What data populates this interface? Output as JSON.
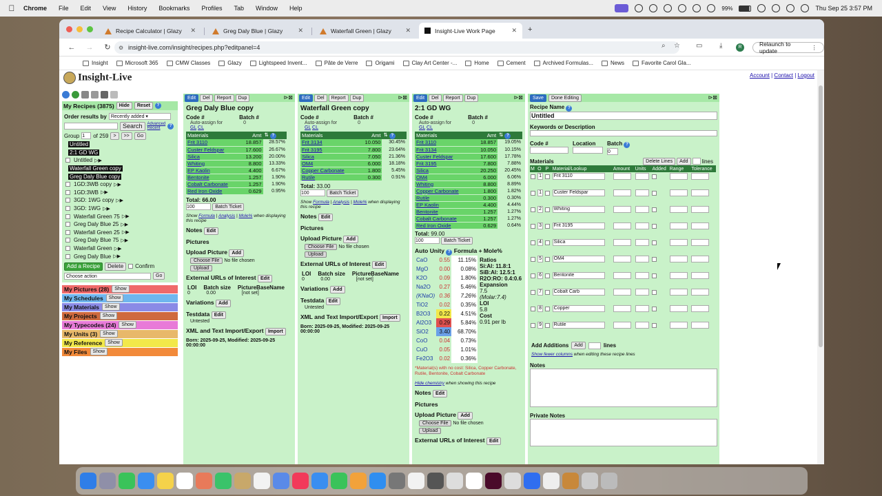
{
  "menubar": {
    "app": "Chrome",
    "items": [
      "File",
      "Edit",
      "View",
      "History",
      "Bookmarks",
      "Profiles",
      "Tab",
      "Window",
      "Help"
    ],
    "battery": "99%",
    "clock": "Thu Sep 25  3:57 PM"
  },
  "tabs": [
    {
      "title": "Recipe Calculator | Glazy"
    },
    {
      "title": "Greg Daly Blue | Glazy"
    },
    {
      "title": "Waterfall Green | Glazy"
    },
    {
      "title": "Insight-Live Work Page"
    }
  ],
  "address": {
    "url": "insight-live.com/insight/recipes.php?editpanel=4",
    "relaunch": "Relaunch to update"
  },
  "bookmarks": [
    "Insight",
    "Microsoft 365",
    "CMW Classes",
    "Glazy",
    "Lightspeed Invent...",
    "Pâte de Verre",
    "Origami",
    "Clay Art Center -...",
    "Home",
    "Cement",
    "Archived Formulas...",
    "News",
    "Favorite Carol Gla..."
  ],
  "header": {
    "logo": "Insight-Live",
    "links": [
      "Account",
      "Contact",
      "Logout"
    ]
  },
  "sidebar": {
    "my_recipes": "My Recipes (3875)",
    "hide": "Hide",
    "reset": "Reset",
    "order_label": "Order results by",
    "order_value": "Recently added",
    "search_btn": "Search",
    "advanced": "Advanced",
    "recent": "Recent",
    "group_label": "Group",
    "group_value": "1",
    "group_of": "of 259",
    "go": "Go",
    "recipes": [
      {
        "name": "Untitled",
        "sel": true
      },
      {
        "name": "2:1 GD WG",
        "sel": true
      },
      {
        "name": "Untitled",
        "sel": false
      },
      {
        "name": "Waterfall Green copy",
        "sel": true
      },
      {
        "name": "Greg Daly Blue copy",
        "sel": true
      },
      {
        "name": "1GD:3WB copy",
        "sel": false
      },
      {
        "name": "1GD:3WB",
        "sel": false
      },
      {
        "name": "3GD: 1WG copy",
        "sel": false
      },
      {
        "name": "3GD: 1WG",
        "sel": false
      },
      {
        "name": "Waterfall Green 75",
        "sel": false
      },
      {
        "name": "Greg Daly Blue 25",
        "sel": false
      },
      {
        "name": "Waterfall Green 25",
        "sel": false
      },
      {
        "name": "Greg Daly Blue 75",
        "sel": false
      },
      {
        "name": "Waterfall Green",
        "sel": false
      },
      {
        "name": "Greg Daly Blue",
        "sel": false
      }
    ],
    "add_recipe": "Add a Recipe",
    "delete": "Delete",
    "confirm": "Confirm",
    "choose_action": "Choose action",
    "categories": [
      {
        "label": "My Pictures (28)",
        "btn": "Show",
        "color": "#ef6a6a"
      },
      {
        "label": "My Schedules",
        "btn": "Show",
        "color": "#6fb6ee"
      },
      {
        "label": "My Materials",
        "btn": "Show",
        "color": "#8a8ae6"
      },
      {
        "label": "My Projects",
        "btn": "Show",
        "color": "#cf6a3e"
      },
      {
        "label": "My Typecodes (24)",
        "btn": "Show",
        "color": "#e87ad8"
      },
      {
        "label": "My Units (3)",
        "btn": "Show",
        "color": "#e8b86a"
      },
      {
        "label": "My Reference",
        "btn": "Show",
        "color": "#f2e84a"
      },
      {
        "label": "My Files",
        "btn": "Show",
        "color": "#f28a3a"
      }
    ]
  },
  "panel_buttons": {
    "edit": "Edit",
    "del": "Del",
    "report": "Report",
    "dup": "Dup"
  },
  "labels": {
    "code": "Code #",
    "batch": "Batch #",
    "auto_assign": "Auto-assign for",
    "gl": "GL",
    "cl": "CL",
    "materials": "Materials",
    "amt": "Amt",
    "total": "Total:",
    "batch_ticket": "Batch Ticket",
    "show": "Show",
    "formula": "Formula",
    "analysis": "Analysis",
    "mole": "Mole%",
    "when_disp": "when displaying this recipe",
    "notes": "Notes",
    "pictures": "Pictures",
    "upload_picture": "Upload Picture",
    "add": "Add",
    "choose_file": "Choose File",
    "no_file": "No file chosen",
    "upload": "Upload",
    "ext_urls": "External URLs of Interest",
    "edit": "Edit",
    "loi": "LOI",
    "batch_size": "Batch size",
    "pbn": "PictureBaseName",
    "variations": "Variations",
    "testdata": "Testdata",
    "untested": "Untested",
    "xml": "XML and Text Import/Export",
    "import": "Import"
  },
  "recipes": [
    {
      "title": "Greg Daly Blue copy",
      "batch_no": "0",
      "materials": [
        [
          "Frit 3110",
          "18.857",
          "28.57%"
        ],
        [
          "Custer Feldspar",
          "17.600",
          "26.67%"
        ],
        [
          "Silica",
          "13.200",
          "20.00%"
        ],
        [
          "Whiting",
          "8.800",
          "13.33%"
        ],
        [
          "EP Kaolin",
          "4.400",
          "6.67%"
        ],
        [
          "Bentonite",
          "1.257",
          "1.90%"
        ],
        [
          "Cobalt Carbonate",
          "1.257",
          "1.90%"
        ],
        [
          "Red Iron Oxide",
          "0.629",
          "0.95%"
        ]
      ],
      "total": "66.00",
      "batch_size": "100",
      "loi": "0",
      "bsize": "0.00",
      "pbn": "[not set]",
      "born": "Born: 2025-09-25, Modified: 2025-09-25 00:00:00"
    },
    {
      "title": "Waterfall Green copy",
      "batch_no": "0",
      "materials": [
        [
          "Frit 3134",
          "10.050",
          "30.45%"
        ],
        [
          "Frit 3195",
          "7.800",
          "23.64%"
        ],
        [
          "Silica",
          "7.050",
          "21.36%"
        ],
        [
          "OM4",
          "6.000",
          "18.18%"
        ],
        [
          "Copper Carbonate",
          "1.800",
          "5.45%"
        ],
        [
          "Rutile",
          "0.300",
          "0.91%"
        ]
      ],
      "total": "33.00",
      "batch_size": "100",
      "loi": "0",
      "bsize": "0.00",
      "pbn": "[not set]",
      "born": "Born: 2025-09-25, Modified: 2025-09-25 00:00:00"
    },
    {
      "title": "2:1 GD WG",
      "batch_no": "0",
      "materials": [
        [
          "Frit 3110",
          "18.857",
          "19.05%"
        ],
        [
          "Frit 3134",
          "10.050",
          "10.15%"
        ],
        [
          "Custer Feldspar",
          "17.600",
          "17.78%"
        ],
        [
          "Frit 3195",
          "7.800",
          "7.88%"
        ],
        [
          "Silica",
          "20.250",
          "20.45%"
        ],
        [
          "OM4",
          "6.000",
          "6.06%"
        ],
        [
          "Whiting",
          "8.800",
          "8.89%"
        ],
        [
          "Copper Carbonate",
          "1.800",
          "1.82%"
        ],
        [
          "Rutile",
          "0.300",
          "0.30%"
        ],
        [
          "EP Kaolin",
          "4.400",
          "4.44%"
        ],
        [
          "Bentonite",
          "1.257",
          "1.27%"
        ],
        [
          "Cobalt Carbonate",
          "1.257",
          "1.27%"
        ],
        [
          "Red Iron Oxide",
          "0.629",
          "0.64%"
        ]
      ],
      "total": "99.00",
      "batch_size": "100"
    }
  ],
  "chem": {
    "auto_unity": "Auto Unity",
    "mode": "Formula + Mole%",
    "rows": [
      [
        "CaO",
        "0.55",
        "11.15%"
      ],
      [
        "MgO",
        "0.00",
        "0.08%"
      ],
      [
        "K2O",
        "0.09",
        "1.80%"
      ],
      [
        "Na2O",
        "0.27",
        "5.46%"
      ],
      [
        "(KNaO)",
        "0.36",
        "7.26%"
      ],
      [
        "TiO2",
        "0.02",
        "0.35%"
      ],
      [
        "B2O3",
        "0.22",
        "4.51%"
      ],
      [
        "Al2O3",
        "0.29",
        "5.84%"
      ],
      [
        "SiO2",
        "3.40",
        "68.70%"
      ],
      [
        "CoO",
        "0.04",
        "0.73%"
      ],
      [
        "CuO",
        "0.05",
        "1.01%"
      ],
      [
        "Fe2O3",
        "0.02",
        "0.36%"
      ]
    ],
    "ratios": "Ratios",
    "si_al": "Si:Al: 11.8:1",
    "sib_al": "SiB:Al: 12.5:1",
    "r2o_ro": "R2O:RO: 0.4:0.6",
    "expansion": "Expansion",
    "exp_val": "7.5",
    "molar": "(Molar:7.4)",
    "loi": "LOI",
    "loi_val": "5.8",
    "cost": "Cost",
    "cost_val": "0.91 per lb",
    "no_cost_note": "*Material(s) with no cost: Silica, Copper Carbonate, Rutile, Bentonite, Cobalt Carbonate",
    "hide_chem": "Hide chemistry",
    "hide_chem_tail": "when showing this recipe"
  },
  "edit": {
    "save": "Save",
    "done": "Done Editing",
    "recipe_name_label": "Recipe Name",
    "recipe_name": "Untitled",
    "keywords_label": "Keywords or Description",
    "code": "Code #",
    "location": "Location",
    "batch": "Batch",
    "batch_value": "0",
    "materials": "Materials",
    "delete_lines": "Delete Lines",
    "add": "Add",
    "lines": "lines",
    "cols": [
      "M",
      "O",
      "P",
      "Material/Lookup",
      "Amount",
      "Units",
      "Added",
      "Range",
      "Tolerance"
    ],
    "rows": [
      [
        "1",
        "Frit 3110"
      ],
      [
        "1",
        "Custer Feldspar"
      ],
      [
        "2",
        "Whiting"
      ],
      [
        "3",
        "Frit 3195"
      ],
      [
        "4",
        "Silica"
      ],
      [
        "5",
        "OM4"
      ],
      [
        "6",
        "Bentonite"
      ],
      [
        "7",
        "Cobalt Carb"
      ],
      [
        "8",
        "Copper"
      ],
      [
        "9",
        "Rutile"
      ]
    ],
    "add_additions": "Add Additions",
    "show_fewer": "Show fewer columns",
    "show_fewer_tail": "when editing these recipe lines",
    "notes": "Notes",
    "private_notes": "Private Notes"
  }
}
